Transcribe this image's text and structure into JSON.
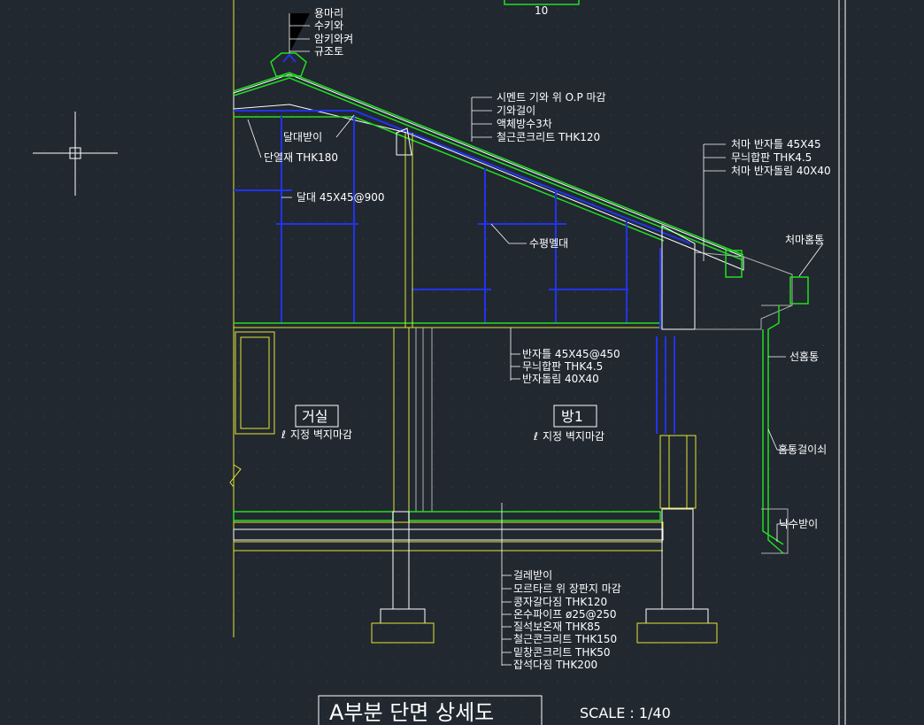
{
  "top_dimension": "10",
  "ridge_notes": [
    "용마리",
    "수키와",
    "암키와켜",
    "규조토"
  ],
  "roof_notes": [
    "시멘트 기와 위 O.P 마감",
    "기와걸이",
    "액체방수3차",
    "철근콘크리트 THK120"
  ],
  "eave_notes": [
    "처마 반자틀 45X45",
    "무늬합판 THK4.5",
    "처마 반자돌림 40X40"
  ],
  "labels": {
    "dalde_bat": "달대받이",
    "insulation": "단열재 THK180",
    "dalde": "달대 45X45@900",
    "level_beam": "수평멜대",
    "eave_gutter": "처마홈통",
    "downpipe": "선홈통",
    "gutter_bracket": "홈통걸이쇠",
    "splash_block": "낙수받이"
  },
  "ceiling_notes": [
    "반자틀 45X45@450",
    "무늬합판 THK4.5",
    "반자돌림 40X40"
  ],
  "rooms": {
    "living": {
      "name": "거실",
      "finish": "지정 벽지마감"
    },
    "room1": {
      "name": "방1",
      "finish": "지정 벽지마감"
    }
  },
  "floor_notes": [
    "걸레받이",
    "모르타르 위 장판지 마감",
    "콩자갈다짐 THK120",
    "온수파이프 ø25@250",
    "질석보온재 THK85",
    "철근콘크리트 THK150",
    "밑창콘크리트 THK50",
    "잡석다짐 THK200"
  ],
  "title": "A부분 단면 상세도",
  "scale": "SCALE : 1/40",
  "colors": {
    "background": "#212830",
    "outline": "#e5e533",
    "finish": "#22dd22",
    "framing": "#2233ee",
    "text": "#ffffff"
  }
}
